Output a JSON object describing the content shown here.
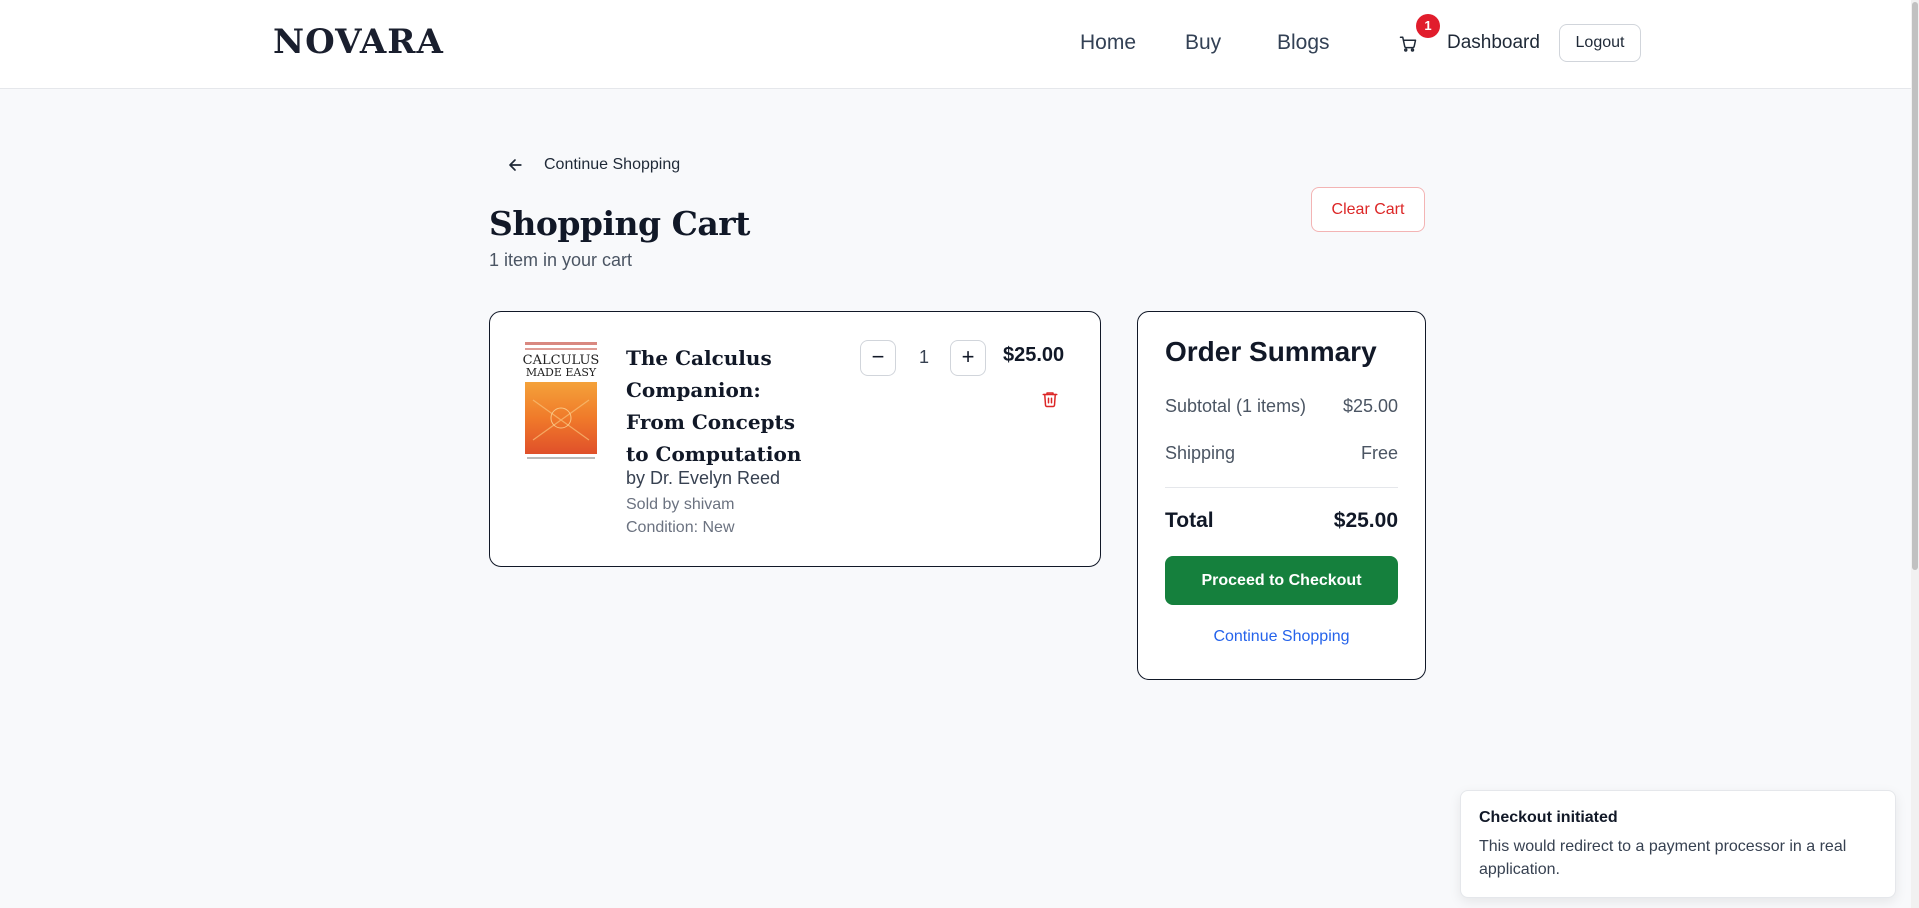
{
  "header": {
    "logo": "NOVARA",
    "nav": [
      "Home",
      "Buy",
      "Blogs"
    ],
    "cart_count": "1",
    "dashboard_label": "Dashboard",
    "logout_label": "Logout"
  },
  "cart": {
    "back_label": "Continue Shopping",
    "title": "Shopping Cart",
    "subtitle": "1 item in your cart",
    "clear_label": "Clear Cart",
    "item": {
      "cover_title": "CALCULUS MADE EASY",
      "title": "The Calculus Companion: From Concepts to Computation",
      "author": "by Dr. Evelyn Reed",
      "seller": "Sold by shivam",
      "condition": "Condition: New",
      "quantity": "1",
      "decrement": "−",
      "increment": "+",
      "price": "$25.00"
    }
  },
  "summary": {
    "title": "Order Summary",
    "subtotal_label": "Subtotal (1 items)",
    "subtotal_value": "$25.00",
    "shipping_label": "Shipping",
    "shipping_value": "Free",
    "total_label": "Total",
    "total_value": "$25.00",
    "checkout_label": "Proceed to Checkout",
    "continue_label": "Continue Shopping"
  },
  "toast": {
    "title": "Checkout initiated",
    "body": "This would redirect to a payment processor in a real application."
  },
  "colors": {
    "accent_green": "#15803d",
    "danger_red": "#dc2626",
    "badge_red": "#e11d2c",
    "link_blue": "#2563eb"
  },
  "icons": [
    "arrow-left-icon",
    "cart-icon",
    "trash-icon",
    "minus-icon",
    "plus-icon"
  ]
}
